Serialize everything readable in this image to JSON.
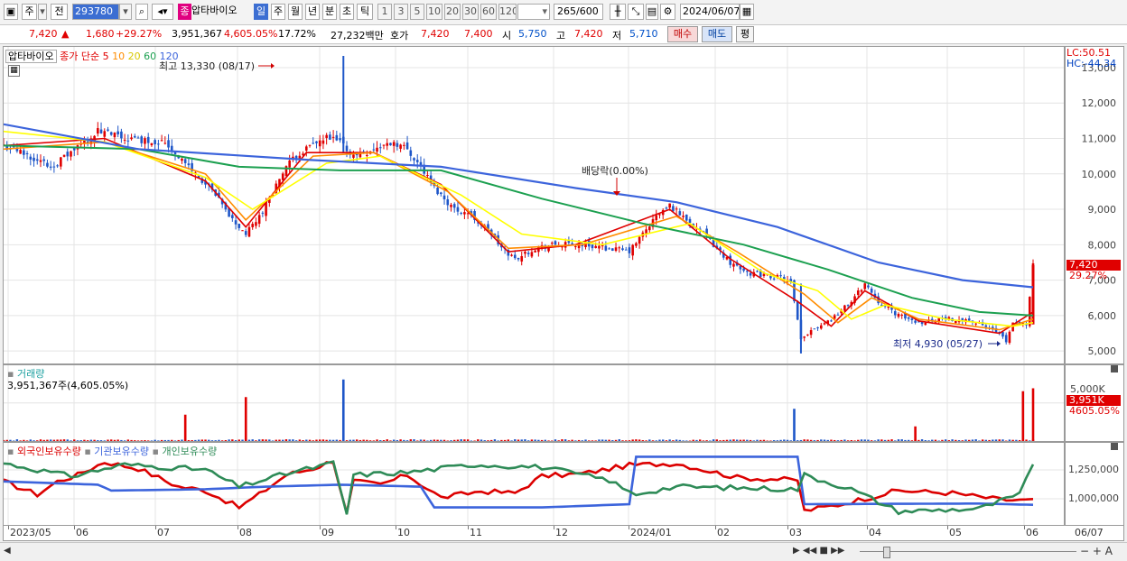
{
  "toolbar": {
    "period_buttons": [
      "주",
      "전"
    ],
    "code": "293780",
    "stock_tag": "종",
    "stock_name": "압타바이오",
    "tf_buttons": [
      "일",
      "주",
      "월",
      "년",
      "분",
      "초",
      "틱"
    ],
    "num_buttons": [
      "1",
      "3",
      "5",
      "10",
      "20",
      "30",
      "60",
      "120"
    ],
    "count_display": "265",
    "count_total": "/600",
    "date": "2024/06/07"
  },
  "quote": {
    "price": "7,420",
    "change_arrow": "▲",
    "change": "1,680",
    "change_pct": "+29.27%",
    "volume": "3,951,367",
    "volume_ratio": "4,605.05%",
    "turnover_pct": "17.72%",
    "amount": "27,232백만",
    "hoga_label": "호가",
    "ask": "7,420",
    "bid": "7,400",
    "open_label": "시",
    "open": "5,750",
    "high_label": "고",
    "high": "7,420",
    "low_label": "저",
    "low": "5,710",
    "buy_btn": "매수",
    "sell_btn": "매도",
    "avg_btn": "평"
  },
  "colors": {
    "up": "#e00000",
    "down": "#1e56c8",
    "ma5": "#e00000",
    "ma10": "#ff8c00",
    "ma20": "#ffff00",
    "ma60": "#1ca050",
    "ma120": "#3c64dc",
    "foreign": "#dc0000",
    "institution": "#3c64dc",
    "individual": "#2e8b57"
  },
  "price_panel": {
    "name": "압타바이오",
    "legend_title": "종가 단순",
    "ma_periods": [
      "5",
      "10",
      "20",
      "60",
      "120"
    ],
    "high_marker": "최고 13,330 (08/17)",
    "low_marker": "최저 4,930 (05/27)",
    "dividend_marker": "배당락(0.00%)",
    "lc": "LC:50.51",
    "hc": "HC:-44.34",
    "last_price_label": "7,420",
    "last_change_label": "29.27%"
  },
  "volume_panel": {
    "title": "거래량",
    "summary": "3,951,367주(4,605.05%)",
    "last_label": "3,951K",
    "last_pct_label": "4605.05%",
    "axis_label": "5,000K"
  },
  "flow_panel": {
    "series_labels": [
      "외국인보유수량",
      "기관보유수량",
      "개인보유수량"
    ],
    "axis_labels": [
      "1,250,000",
      "1,000,000"
    ]
  },
  "x_axis_labels": [
    "2023/05",
    "06",
    "07",
    "08",
    "09",
    "10",
    "11",
    "12",
    "2024/01",
    "02",
    "03",
    "04",
    "05",
    "06",
    "06/07"
  ],
  "chart_data": {
    "type": "candlestick",
    "title": "압타바이오",
    "ylim": [
      4800,
      13330
    ],
    "y_ticks": [
      5000,
      6000,
      7000,
      8000,
      9000,
      10000,
      11000,
      12000,
      13000
    ],
    "y_tick_labels": [
      "5,000",
      "6,000",
      "7,000",
      "8,000",
      "9,000",
      "10,000",
      "11,000",
      "12,000",
      "13,000"
    ],
    "x_months": [
      "2023/05",
      "06",
      "07",
      "08",
      "09",
      "10",
      "11",
      "12",
      "2024/01",
      "02",
      "03",
      "04",
      "05",
      "06"
    ],
    "price_path": [
      [
        0,
        10800
      ],
      [
        8,
        10500
      ],
      [
        14,
        10200
      ],
      [
        20,
        10600
      ],
      [
        28,
        11200
      ],
      [
        36,
        11000
      ],
      [
        48,
        10900
      ],
      [
        56,
        10100
      ],
      [
        62,
        9500
      ],
      [
        68,
        8700
      ],
      [
        72,
        8300
      ],
      [
        76,
        8800
      ],
      [
        80,
        9500
      ],
      [
        84,
        10200
      ],
      [
        88,
        10600
      ],
      [
        92,
        10800
      ],
      [
        96,
        11000
      ],
      [
        100,
        10900
      ],
      [
        104,
        10500
      ],
      [
        110,
        10700
      ],
      [
        116,
        10900
      ],
      [
        120,
        10700
      ],
      [
        124,
        10200
      ],
      [
        128,
        9600
      ],
      [
        134,
        9000
      ],
      [
        138,
        8900
      ],
      [
        144,
        8400
      ],
      [
        148,
        7900
      ],
      [
        152,
        7600
      ],
      [
        158,
        7900
      ],
      [
        164,
        8000
      ],
      [
        172,
        8000
      ],
      [
        180,
        7900
      ],
      [
        186,
        7800
      ],
      [
        190,
        8300
      ],
      [
        194,
        8800
      ],
      [
        198,
        9100
      ],
      [
        202,
        8800
      ],
      [
        206,
        8500
      ],
      [
        210,
        8100
      ],
      [
        216,
        7500
      ],
      [
        222,
        7200
      ],
      [
        228,
        7100
      ],
      [
        232,
        7050
      ],
      [
        234,
        6900
      ],
      [
        237,
        5300
      ],
      [
        240,
        5600
      ],
      [
        246,
        5900
      ],
      [
        252,
        6400
      ],
      [
        256,
        6900
      ],
      [
        260,
        6400
      ],
      [
        266,
        6000
      ],
      [
        272,
        5800
      ],
      [
        278,
        5900
      ],
      [
        286,
        5900
      ],
      [
        294,
        5600
      ],
      [
        298,
        5300
      ],
      [
        300,
        5750
      ],
      [
        304,
        5760
      ],
      [
        306,
        7420
      ]
    ],
    "moving_averages": [
      {
        "name": "5",
        "points": [
          [
            0,
            10800
          ],
          [
            30,
            11000
          ],
          [
            60,
            9800
          ],
          [
            72,
            8500
          ],
          [
            90,
            10600
          ],
          [
            110,
            10600
          ],
          [
            130,
            9700
          ],
          [
            150,
            7800
          ],
          [
            170,
            8000
          ],
          [
            198,
            9000
          ],
          [
            216,
            7600
          ],
          [
            236,
            6400
          ],
          [
            246,
            5700
          ],
          [
            256,
            6700
          ],
          [
            272,
            5850
          ],
          [
            296,
            5500
          ],
          [
            306,
            6100
          ]
        ]
      },
      {
        "name": "10",
        "points": [
          [
            0,
            10700
          ],
          [
            30,
            10900
          ],
          [
            60,
            10000
          ],
          [
            72,
            8700
          ],
          [
            92,
            10500
          ],
          [
            110,
            10600
          ],
          [
            132,
            9500
          ],
          [
            150,
            7900
          ],
          [
            172,
            8000
          ],
          [
            200,
            8800
          ],
          [
            218,
            7800
          ],
          [
            238,
            6600
          ],
          [
            248,
            5800
          ],
          [
            258,
            6500
          ],
          [
            272,
            5900
          ],
          [
            296,
            5600
          ],
          [
            306,
            5900
          ]
        ]
      },
      {
        "name": "20",
        "points": [
          [
            0,
            11200
          ],
          [
            30,
            10900
          ],
          [
            60,
            9900
          ],
          [
            74,
            9000
          ],
          [
            96,
            10300
          ],
          [
            112,
            10500
          ],
          [
            136,
            9400
          ],
          [
            154,
            8300
          ],
          [
            178,
            8000
          ],
          [
            204,
            8600
          ],
          [
            226,
            7200
          ],
          [
            242,
            6700
          ],
          [
            252,
            5900
          ],
          [
            262,
            6300
          ],
          [
            280,
            5900
          ],
          [
            300,
            5700
          ],
          [
            306,
            5800
          ]
        ]
      },
      {
        "name": "60",
        "points": [
          [
            0,
            10800
          ],
          [
            40,
            10700
          ],
          [
            70,
            10200
          ],
          [
            100,
            10100
          ],
          [
            130,
            10100
          ],
          [
            160,
            9300
          ],
          [
            190,
            8600
          ],
          [
            220,
            8000
          ],
          [
            245,
            7300
          ],
          [
            270,
            6500
          ],
          [
            290,
            6100
          ],
          [
            306,
            6000
          ]
        ]
      },
      {
        "name": "120",
        "points": [
          [
            0,
            11400
          ],
          [
            40,
            10700
          ],
          [
            90,
            10400
          ],
          [
            130,
            10200
          ],
          [
            170,
            9600
          ],
          [
            200,
            9200
          ],
          [
            230,
            8500
          ],
          [
            260,
            7500
          ],
          [
            285,
            7000
          ],
          [
            306,
            6800
          ]
        ]
      }
    ],
    "volume_spikes": [
      [
        54,
        900
      ],
      [
        72,
        1500
      ],
      [
        101,
        2100
      ],
      [
        235,
        1100
      ],
      [
        271,
        500
      ],
      [
        303,
        1700
      ],
      [
        306,
        1800
      ]
    ],
    "volume_ylim": [
      0,
      2400
    ],
    "flow_series": [
      {
        "name": "외국인보유수량",
        "points": [
          [
            0,
            60
          ],
          [
            10,
            40
          ],
          [
            16,
            60
          ],
          [
            22,
            70
          ],
          [
            30,
            90
          ],
          [
            40,
            80
          ],
          [
            52,
            52
          ],
          [
            60,
            46
          ],
          [
            70,
            20
          ],
          [
            76,
            40
          ],
          [
            84,
            70
          ],
          [
            92,
            80
          ],
          [
            98,
            92
          ],
          [
            102,
            10
          ],
          [
            104,
            60
          ],
          [
            112,
            55
          ],
          [
            120,
            70
          ],
          [
            130,
            35
          ],
          [
            142,
            45
          ],
          [
            152,
            42
          ],
          [
            160,
            68
          ],
          [
            172,
            72
          ],
          [
            186,
            85
          ],
          [
            200,
            88
          ],
          [
            218,
            66
          ],
          [
            236,
            62
          ],
          [
            237,
            14
          ],
          [
            248,
            24
          ],
          [
            266,
            46
          ],
          [
            282,
            42
          ],
          [
            296,
            32
          ],
          [
            306,
            30
          ]
        ]
      },
      {
        "name": "기관보유수량",
        "points": [
          [
            0,
            60
          ],
          [
            28,
            55
          ],
          [
            32,
            46
          ],
          [
            60,
            48
          ],
          [
            78,
            52
          ],
          [
            100,
            55
          ],
          [
            124,
            52
          ],
          [
            128,
            20
          ],
          [
            160,
            20
          ],
          [
            186,
            25
          ],
          [
            187,
            98
          ],
          [
            236,
            98
          ],
          [
            237,
            25
          ],
          [
            290,
            26
          ],
          [
            306,
            24
          ]
        ]
      },
      {
        "name": "개인보유수량",
        "points": [
          [
            0,
            88
          ],
          [
            20,
            68
          ],
          [
            36,
            86
          ],
          [
            60,
            78
          ],
          [
            70,
            52
          ],
          [
            84,
            72
          ],
          [
            98,
            88
          ],
          [
            102,
            10
          ],
          [
            104,
            70
          ],
          [
            120,
            74
          ],
          [
            140,
            86
          ],
          [
            160,
            82
          ],
          [
            180,
            62
          ],
          [
            187,
            40
          ],
          [
            200,
            52
          ],
          [
            236,
            48
          ],
          [
            238,
            70
          ],
          [
            252,
            48
          ],
          [
            266,
            14
          ],
          [
            290,
            18
          ],
          [
            302,
            40
          ],
          [
            306,
            85
          ]
        ]
      }
    ]
  }
}
